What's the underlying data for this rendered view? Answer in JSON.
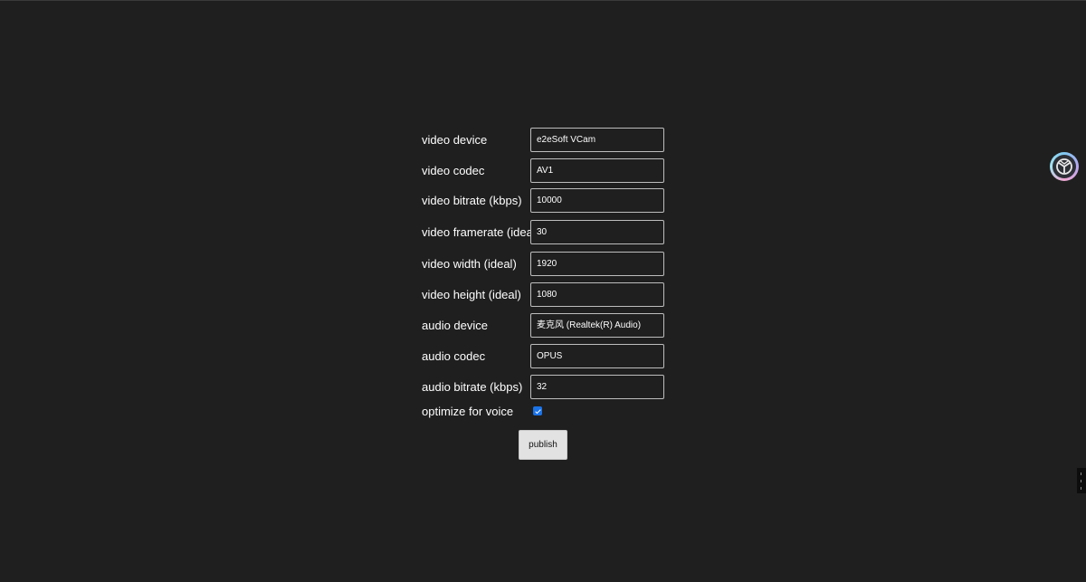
{
  "form": {
    "fields": [
      {
        "label": "video device",
        "value": "e2eSoft VCam"
      },
      {
        "label": "video codec",
        "value": "AV1"
      },
      {
        "label": "video bitrate (kbps)",
        "value": "10000"
      },
      {
        "label": "video framerate (ideal)",
        "value": "30"
      },
      {
        "label": "video width (ideal)",
        "value": "1920"
      },
      {
        "label": "video height (ideal)",
        "value": "1080"
      },
      {
        "label": "audio device",
        "value": "麦克风 (Realtek(R) Audio)"
      },
      {
        "label": "audio codec",
        "value": "OPUS"
      },
      {
        "label": "audio bitrate (kbps)",
        "value": "32"
      }
    ],
    "optimize_label": "optimize for voice",
    "optimize_checked": true,
    "publish_label": "publish"
  },
  "icons": {
    "extension_badge": "extension-logo-icon",
    "edge_tab": "side-panel-handle-icon"
  },
  "colors": {
    "background": "#1f1f1f",
    "checkbox_accent": "#1a73e8",
    "button_bg": "#e2e2e2"
  }
}
